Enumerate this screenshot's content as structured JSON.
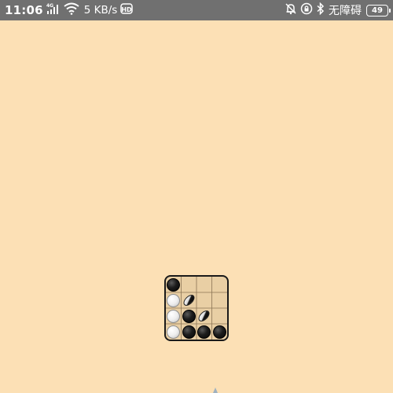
{
  "status_bar": {
    "time": "11:06",
    "network_type": "4G",
    "speed": "5 KB/s",
    "hd_badge": "HD",
    "status_text": "无障碍",
    "battery": "49",
    "icons": [
      "notification-muted-icon",
      "wifi-icon",
      "signal-icon",
      "hd-icon",
      "alarm-off-icon",
      "lock-rotation-icon",
      "bluetooth-icon"
    ]
  },
  "board": {
    "size": 4,
    "cells": [
      [
        "black",
        "empty",
        "empty",
        "empty"
      ],
      [
        "white",
        "flipping",
        "empty",
        "empty"
      ],
      [
        "white",
        "black",
        "flipping",
        "empty"
      ],
      [
        "white",
        "black",
        "black",
        "black"
      ]
    ]
  },
  "colors": {
    "background": "#FCE0B5",
    "status_bar": "#707070",
    "board": "#E9CFA4"
  }
}
